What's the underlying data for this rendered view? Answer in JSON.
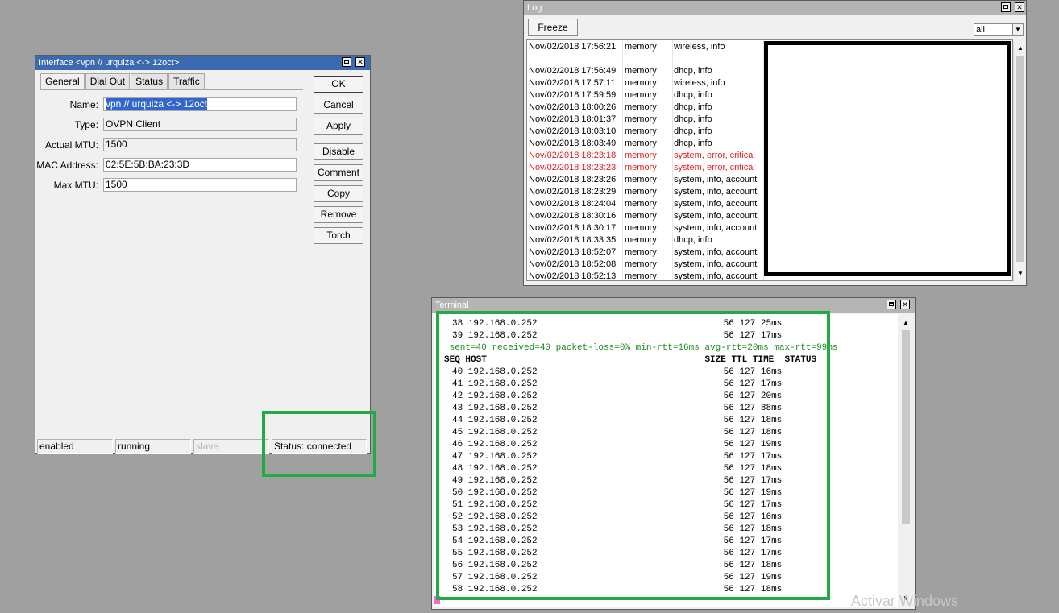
{
  "interface_window": {
    "title": "Interface <vpn // urquiza <-> 12oct>",
    "tabs": [
      "General",
      "Dial Out",
      "Status",
      "Traffic"
    ],
    "fields": [
      {
        "label": "Name:",
        "value": "vpn // urquiza <-> 12oct"
      },
      {
        "label": "Type:",
        "value": "OVPN Client"
      },
      {
        "label": "Actual MTU:",
        "value": "1500"
      },
      {
        "label": "MAC Address:",
        "value": "02:5E:5B:BA:23:3D"
      },
      {
        "label": "Max MTU:",
        "value": "1500"
      }
    ],
    "buttons": [
      "OK",
      "Cancel",
      "Apply",
      "Disable",
      "Comment",
      "Copy",
      "Remove",
      "Torch"
    ],
    "status_bar": [
      "enabled",
      "running",
      "slave",
      "Status: connected"
    ]
  },
  "log_window": {
    "title": "Log",
    "freeze_label": "Freeze",
    "filter_value": "all",
    "rows": [
      {
        "time": "Nov/02/2018 17:56:21",
        "buffer": "memory",
        "topics": "wireless, info",
        "error": false
      },
      {
        "time": "Nov/02/2018 17:56:49",
        "buffer": "memory",
        "topics": "dhcp, info",
        "error": false
      },
      {
        "time": "Nov/02/2018 17:57:11",
        "buffer": "memory",
        "topics": "wireless, info",
        "error": false
      },
      {
        "time": "Nov/02/2018 17:59:59",
        "buffer": "memory",
        "topics": "dhcp, info",
        "error": false
      },
      {
        "time": "Nov/02/2018 18:00:26",
        "buffer": "memory",
        "topics": "dhcp, info",
        "error": false
      },
      {
        "time": "Nov/02/2018 18:01:37",
        "buffer": "memory",
        "topics": "dhcp, info",
        "error": false
      },
      {
        "time": "Nov/02/2018 18:03:10",
        "buffer": "memory",
        "topics": "dhcp, info",
        "error": false
      },
      {
        "time": "Nov/02/2018 18:03:49",
        "buffer": "memory",
        "topics": "dhcp, info",
        "error": false
      },
      {
        "time": "Nov/02/2018 18:23:18",
        "buffer": "memory",
        "topics": "system, error, critical",
        "error": true
      },
      {
        "time": "Nov/02/2018 18:23:23",
        "buffer": "memory",
        "topics": "system, error, critical",
        "error": true
      },
      {
        "time": "Nov/02/2018 18:23:26",
        "buffer": "memory",
        "topics": "system, info, account",
        "error": false
      },
      {
        "time": "Nov/02/2018 18:23:29",
        "buffer": "memory",
        "topics": "system, info, account",
        "error": false
      },
      {
        "time": "Nov/02/2018 18:24:04",
        "buffer": "memory",
        "topics": "system, info, account",
        "error": false
      },
      {
        "time": "Nov/02/2018 18:30:16",
        "buffer": "memory",
        "topics": "system, info, account",
        "error": false
      },
      {
        "time": "Nov/02/2018 18:30:17",
        "buffer": "memory",
        "topics": "system, info, account",
        "error": false
      },
      {
        "time": "Nov/02/2018 18:33:35",
        "buffer": "memory",
        "topics": "dhcp, info",
        "error": false
      },
      {
        "time": "Nov/02/2018 18:52:07",
        "buffer": "memory",
        "topics": "system, info, account",
        "error": false
      },
      {
        "time": "Nov/02/2018 18:52:08",
        "buffer": "memory",
        "topics": "system, info, account",
        "error": false
      },
      {
        "time": "Nov/02/2018 18:52:13",
        "buffer": "memory",
        "topics": "system, info, account",
        "error": false
      }
    ]
  },
  "terminal_window": {
    "title": "Terminal",
    "lines": [
      {
        "text": "38 192.168.0.252                                   56 127 25ms",
        "style": "normal"
      },
      {
        "text": "39 192.168.0.252                                   56 127 17ms",
        "style": "normal"
      },
      {
        "text": " sent=40 received=40 packet-loss=0% min-rtt=16ms avg-rtt=20ms max-rtt=99ms",
        "style": "green"
      },
      {
        "text": "SEQ HOST                                         SIZE TTL TIME  STATUS",
        "style": "hdr"
      },
      {
        "text": "40 192.168.0.252                                   56 127 16ms",
        "style": "normal"
      },
      {
        "text": "41 192.168.0.252                                   56 127 17ms",
        "style": "normal"
      },
      {
        "text": "42 192.168.0.252                                   56 127 20ms",
        "style": "normal"
      },
      {
        "text": "43 192.168.0.252                                   56 127 88ms",
        "style": "normal"
      },
      {
        "text": "44 192.168.0.252                                   56 127 18ms",
        "style": "normal"
      },
      {
        "text": "45 192.168.0.252                                   56 127 18ms",
        "style": "normal"
      },
      {
        "text": "46 192.168.0.252                                   56 127 19ms",
        "style": "normal"
      },
      {
        "text": "47 192.168.0.252                                   56 127 17ms",
        "style": "normal"
      },
      {
        "text": "48 192.168.0.252                                   56 127 18ms",
        "style": "normal"
      },
      {
        "text": "49 192.168.0.252                                   56 127 17ms",
        "style": "normal"
      },
      {
        "text": "50 192.168.0.252                                   56 127 19ms",
        "style": "normal"
      },
      {
        "text": "51 192.168.0.252                                   56 127 17ms",
        "style": "normal"
      },
      {
        "text": "52 192.168.0.252                                   56 127 16ms",
        "style": "normal"
      },
      {
        "text": "53 192.168.0.252                                   56 127 18ms",
        "style": "normal"
      },
      {
        "text": "54 192.168.0.252                                   56 127 17ms",
        "style": "normal"
      },
      {
        "text": "55 192.168.0.252                                   56 127 17ms",
        "style": "normal"
      },
      {
        "text": "56 192.168.0.252                                   56 127 18ms",
        "style": "normal"
      },
      {
        "text": "57 192.168.0.252                                   56 127 19ms",
        "style": "normal"
      },
      {
        "text": "58 192.168.0.252                                   56 127 18ms",
        "style": "normal"
      }
    ]
  },
  "watermark": "Activar Windows",
  "colors": {
    "highlight_box": "#22aa44",
    "active_titlebar": "#3c6ab0",
    "error_text": "#e02020",
    "desktop": "#a0a0a0"
  }
}
